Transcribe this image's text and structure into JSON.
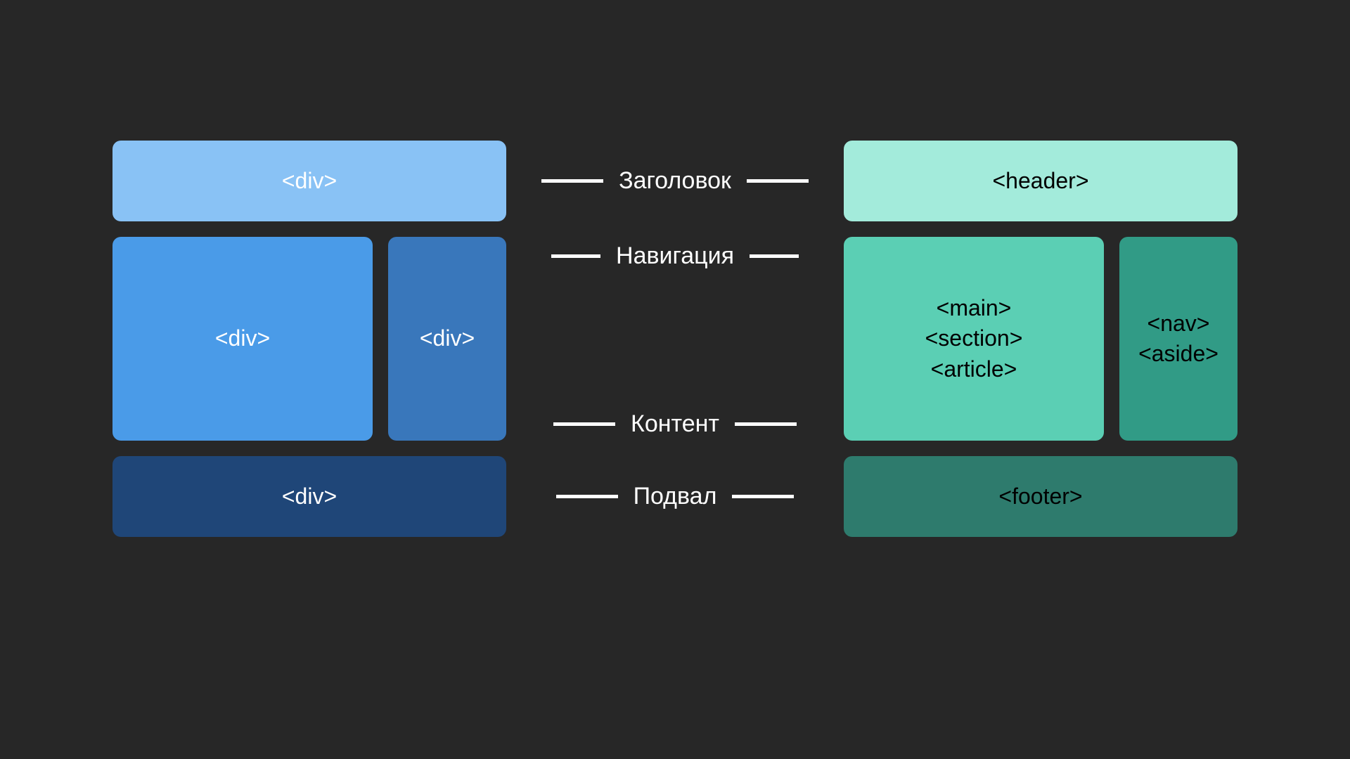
{
  "left": {
    "header": "<div>",
    "content": "<div>",
    "nav": "<div>",
    "footer": "<div>"
  },
  "labels": {
    "header": "Заголовок",
    "navigation": "Навигация",
    "content": "Контент",
    "footer": "Подвал"
  },
  "right": {
    "header": "<header>",
    "content": "<main>\n<section>\n<article>",
    "nav": "<nav>\n<aside>",
    "footer": "<footer>"
  },
  "colors": {
    "background": "#272727",
    "left_palette": [
      "#89c2f5",
      "#4a9be8",
      "#3977bb",
      "#1f4678"
    ],
    "right_palette": [
      "#a3ebdb",
      "#5bcfb4",
      "#319b86",
      "#2e7b6d"
    ],
    "connector": "#ffffff"
  }
}
